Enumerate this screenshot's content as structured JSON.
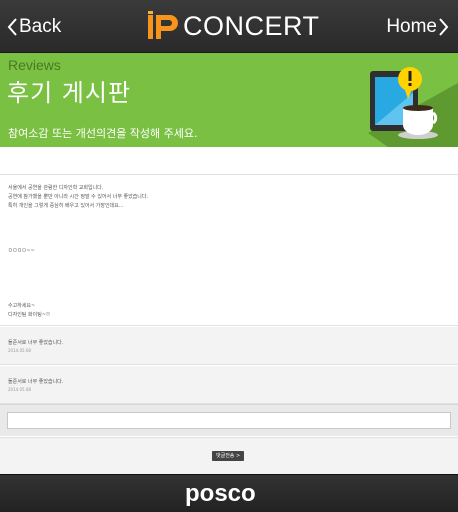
{
  "header": {
    "back_label": "Back",
    "home_label": "Home",
    "logo_mark": "IP",
    "logo_text": "CONCERT"
  },
  "banner": {
    "subtitle": "Reviews",
    "title": "후기 게시판",
    "description": "참여소감 또는 개선의견을 작성해 주세요.",
    "accent_color": "#7ac043"
  },
  "post": {
    "lines": [
      "서울에서 공연을 관람한 디자인학 교회입니다.",
      "공연에 참가했을 뿐만 아니라 시간 정말 수 있어서 너무 좋았습니다.",
      "특히 개인을 그렇게 중심히 배우고 있어서 가장인데요...",
      "ㅁㅁㅁㅁ~~",
      "수고하세요~",
      "디자인팀 화이팅~!!"
    ]
  },
  "comments": [
    {
      "text": "돌준서로 너무 좋았습니다.",
      "date": "2014.05.08"
    },
    {
      "text": "돌준서로 너무 좋았습니다.",
      "date": "2014.05.08"
    }
  ],
  "comment_form": {
    "placeholder": "",
    "submit_label": "댓글전송 >"
  },
  "footer": {
    "logo_text": "posco"
  }
}
